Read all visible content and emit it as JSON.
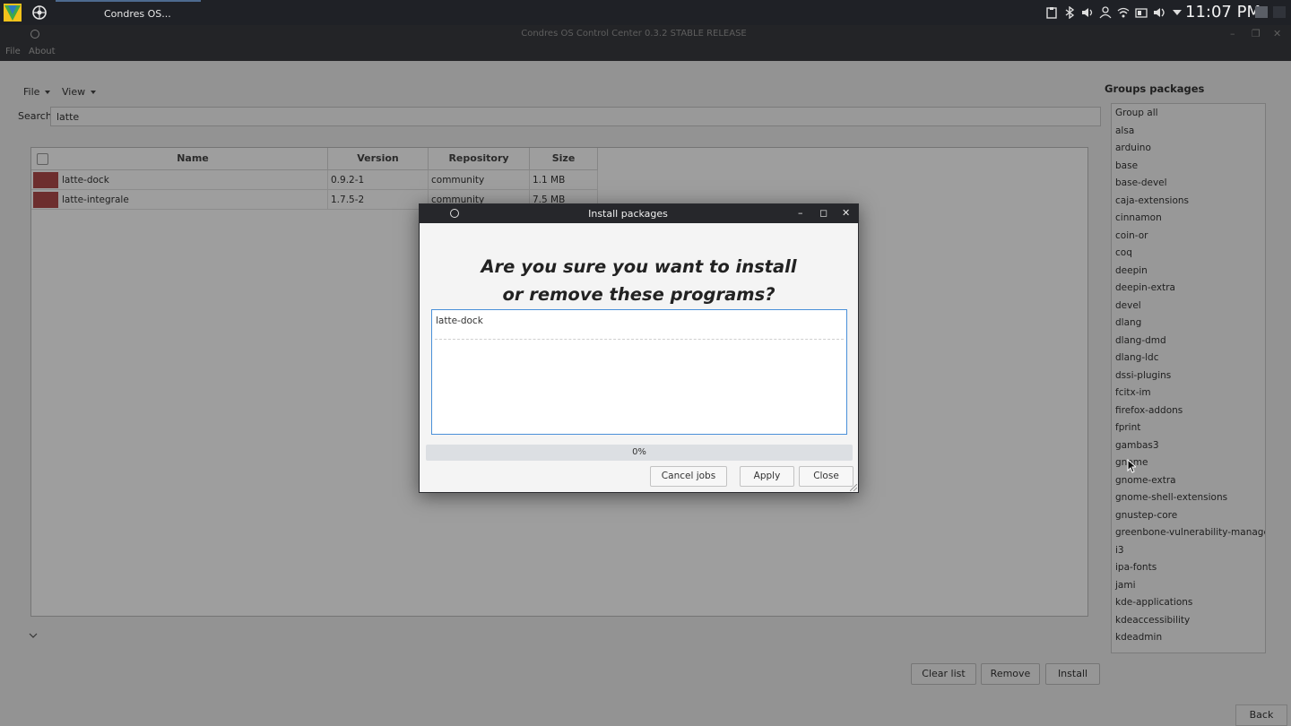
{
  "taskbar": {
    "task_label": "Condres OS...",
    "clock": "11:07 PM",
    "tray_icons": [
      "clipboard-icon",
      "bluetooth-icon",
      "volume-icon",
      "user-icon",
      "wifi-icon",
      "battery-icon",
      "speaker-icon",
      "arrow-down-icon"
    ]
  },
  "window": {
    "title": "Condres OS Control Center 0.3.2 STABLE RELEASE",
    "menu": [
      "File",
      "About"
    ]
  },
  "main": {
    "toolbar": [
      "File",
      "View"
    ],
    "search_label": "Search",
    "search_value": "latte",
    "columns": [
      "Name",
      "Version",
      "Repository",
      "Size"
    ],
    "rows": [
      {
        "name": "latte-dock",
        "version": "0.9.2-1",
        "repository": "community",
        "size": "1.1 MB"
      },
      {
        "name": "latte-integrale",
        "version": "1.7.5-2",
        "repository": "community",
        "size": "7.5 MB"
      }
    ],
    "buttons": [
      "Clear list",
      "Remove",
      "Install"
    ],
    "back": "Back"
  },
  "groups": {
    "title": "Groups packages",
    "items": [
      "Group all",
      "alsa",
      "arduino",
      "base",
      "base-devel",
      "caja-extensions",
      "cinnamon",
      "coin-or",
      "coq",
      "deepin",
      "deepin-extra",
      "devel",
      "dlang",
      "dlang-dmd",
      "dlang-ldc",
      "dssi-plugins",
      "fcitx-im",
      "firefox-addons",
      "fprint",
      "gambas3",
      "gnome",
      "gnome-extra",
      "gnome-shell-extensions",
      "gnustep-core",
      "greenbone-vulnerability-manager",
      "i3",
      "ipa-fonts",
      "jami",
      "kde-applications",
      "kdeaccessibility",
      "kdeadmin"
    ]
  },
  "dialog": {
    "title": "Install packages",
    "question_line1": "Are you sure you want to install",
    "question_line2": "or remove these programs?",
    "packages": [
      "latte-dock"
    ],
    "progress_text": "0%",
    "progress": 0,
    "buttons": {
      "cancel": "Cancel jobs",
      "apply": "Apply",
      "close": "Close"
    }
  },
  "colors": {
    "accent": "#4a90d9",
    "row_swatch": "#b04b4b",
    "taskbar_bg": "#1f2126",
    "titlebar_bg": "#232427"
  }
}
